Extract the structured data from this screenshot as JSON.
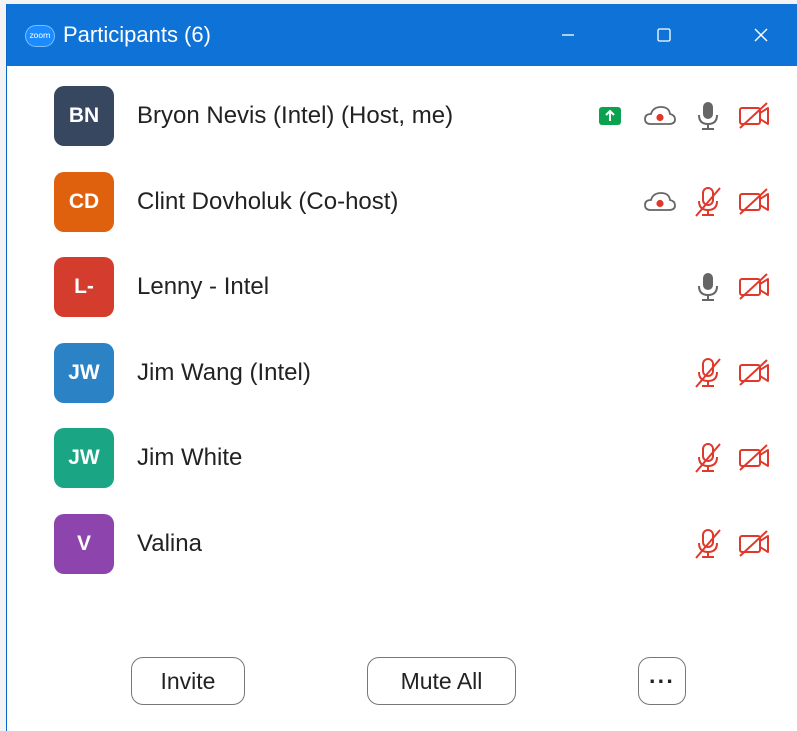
{
  "window": {
    "logo_text": "zoom",
    "title": "Participants (6)",
    "accent": "#0e72d6"
  },
  "participants": [
    {
      "initials": "BN",
      "name": "Bryon Nevis (Intel) (Host, me)",
      "avatar_color": "#36475f",
      "sharing": true,
      "recording": true,
      "mic": "on",
      "video": "off"
    },
    {
      "initials": "CD",
      "name": "Clint Dovholuk (Co-host)",
      "avatar_color": "#e0610d",
      "sharing": false,
      "recording": true,
      "mic": "muted",
      "video": "off"
    },
    {
      "initials": "L-",
      "name": "Lenny - Intel",
      "avatar_color": "#d43c2e",
      "sharing": false,
      "recording": false,
      "mic": "on",
      "video": "off"
    },
    {
      "initials": "JW",
      "name": "Jim Wang (Intel)",
      "avatar_color": "#2b83c6",
      "sharing": false,
      "recording": false,
      "mic": "muted",
      "video": "off"
    },
    {
      "initials": "JW",
      "name": "Jim White",
      "avatar_color": "#1aa585",
      "sharing": false,
      "recording": false,
      "mic": "muted",
      "video": "off"
    },
    {
      "initials": "V",
      "name": "Valina",
      "avatar_color": "#8e44ad",
      "sharing": false,
      "recording": false,
      "mic": "muted",
      "video": "off"
    }
  ],
  "footer": {
    "invite_label": "Invite",
    "mute_all_label": "Mute All",
    "more_label": "···"
  },
  "colors": {
    "muted_red": "#e0392b",
    "share_green": "#0aa14f",
    "icon_gray": "#666666"
  }
}
